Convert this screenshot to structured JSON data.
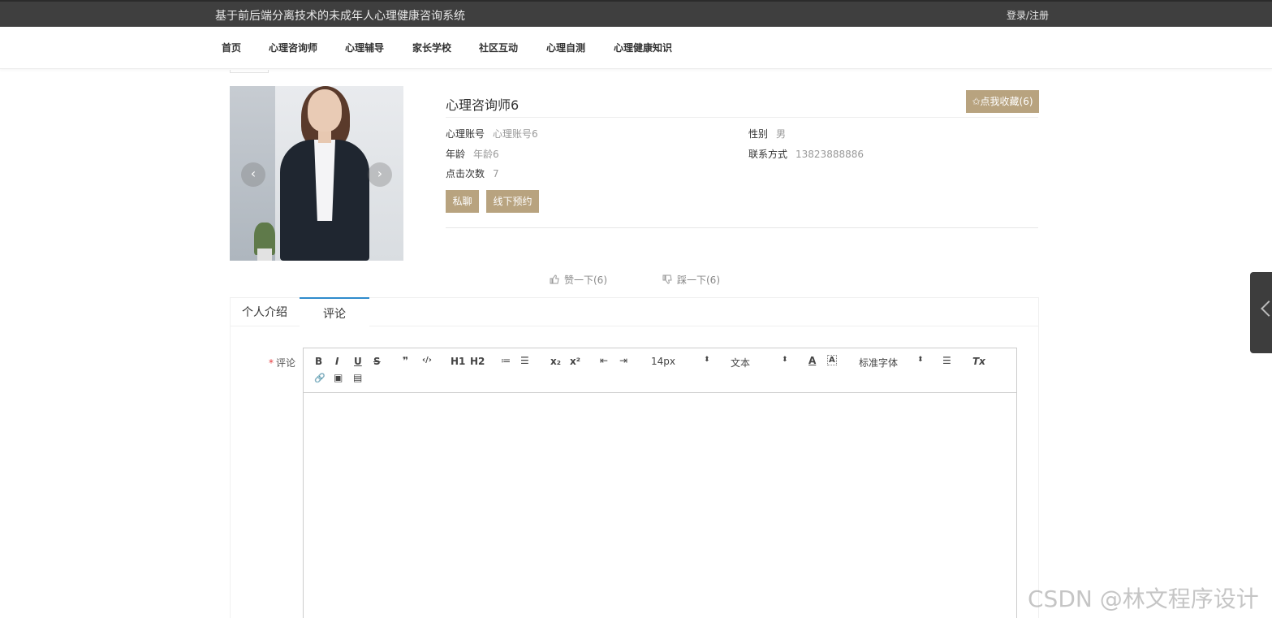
{
  "header": {
    "system_title": "基于前后端分离技术的未成年人心理健康咨询系统",
    "login_label": "登录/注册"
  },
  "nav": {
    "items": [
      "首页",
      "心理咨询师",
      "心理辅导",
      "家长学校",
      "社区互动",
      "心理自测",
      "心理健康知识"
    ]
  },
  "carousel": {
    "prev_glyph": "‹",
    "next_glyph": "›"
  },
  "detail": {
    "title": "心理咨询师6",
    "favorite_label": "✩点我收藏(6)",
    "fields": {
      "account": {
        "label": "心理账号",
        "value": "心理账号6"
      },
      "gender": {
        "label": "性别",
        "value": "男"
      },
      "age": {
        "label": "年龄",
        "value": "年龄6"
      },
      "contact": {
        "label": "联系方式",
        "value": "13823888886"
      },
      "clicks": {
        "label": "点击次数",
        "value": "7"
      }
    },
    "chat_label": "私聊",
    "appointment_label": "线下预约"
  },
  "votes": {
    "like_label": "赞一下(6)",
    "dislike_label": "踩一下(6)"
  },
  "tabs": {
    "items": [
      "个人介绍",
      "评论"
    ],
    "active_index": 1
  },
  "comment_form": {
    "required_mark": "*",
    "label": "评论",
    "font_size": "14px",
    "block_type": "文本",
    "font_family_option": "标准字体"
  },
  "toolbar_glyphs": {
    "bold": "B",
    "italic": "I",
    "underline": "U",
    "strike": "S",
    "quote": "❞",
    "code": "‹/›",
    "h1": "H1",
    "h2": "H2",
    "ordered_list": "≔",
    "bullet_list": "☰",
    "subscript": "x₂",
    "superscript": "x²",
    "outdent": "⇤",
    "indent": "⇥",
    "font_color": "A",
    "background_color": "A",
    "align": "☰",
    "clean": "Tx",
    "link": "🔗",
    "image": "▣",
    "video": "▤",
    "picker_arrow": "⬍"
  },
  "watermark": "CSDN @林文程序设计"
}
